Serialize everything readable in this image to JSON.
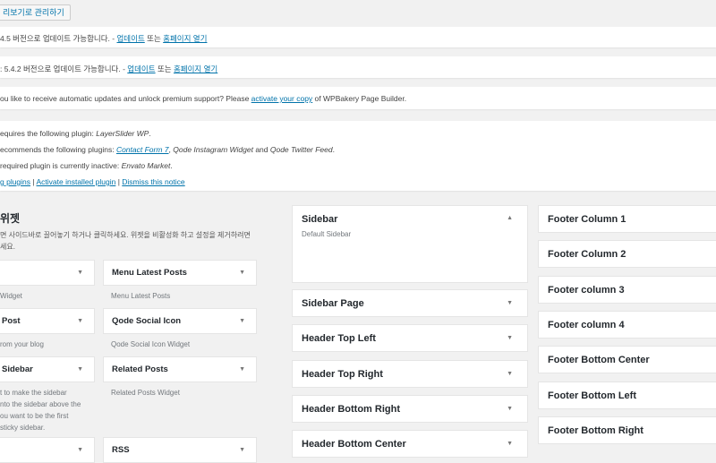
{
  "manage_button": "리보기로 관리하기",
  "notices": [
    {
      "text": "4.5 버전으로 업데이트 가능합니다. - ",
      "update": "업데이트",
      "or": " 또는 ",
      "homepage": "홈페이지 열기"
    },
    {
      "text": ": 5.4.2 버전으로 업데이트 가능합니다. - ",
      "update": "업데이트",
      "or": " 또는 ",
      "homepage": "홈페이지 열기"
    }
  ],
  "wpbakery": {
    "text": "ou like to receive automatic updates and unlock premium support? Please ",
    "link": "activate your copy",
    "suffix": " of WPBakery Page Builder."
  },
  "plugins": {
    "line1": "equires the following plugin: ",
    "line1_em": "LayerSlider WP",
    "line2": "ecommends the following plugins: ",
    "contact": "Contact Form 7",
    "qiw": "Qode Instagram Widget",
    "and": " and ",
    "qtf": "Qode Twitter Feed",
    "line3": " required plugin is currently inactive: ",
    "line3_em": "Envato Market",
    "link1": "g plugins",
    "link2": "Activate installed plugin",
    "link3": "Dismiss this notice",
    "sep": " | "
  },
  "widgets": {
    "title": "위젯",
    "desc1": "면 사이드바로 끌어놓기 하거나 클릭하세요. 위젯을 비활성화 하고 설정을 제거하려면",
    "desc2": "세요.",
    "items": [
      {
        "title": "",
        "desc": "Widget"
      },
      {
        "title": "Menu Latest Posts",
        "desc": "Menu Latest Posts"
      },
      {
        "title": "Post",
        "desc": "rom your blog"
      },
      {
        "title": "Qode Social Icon",
        "desc": "Qode Social Icon Widget"
      },
      {
        "title": "Sidebar",
        "desc": "t to make the sidebar\nnto the sidebar above the\nou want to be the first\nsticky sidebar."
      },
      {
        "title": "Related Posts",
        "desc": "Related Posts Widget"
      },
      {
        "title": "",
        "desc": ""
      },
      {
        "title": "RSS",
        "desc": ""
      }
    ]
  },
  "sidebars": {
    "main": {
      "title": "Sidebar",
      "desc": "Default Sidebar"
    },
    "items": [
      "Sidebar Page",
      "Header Top Left",
      "Header Top Right",
      "Header Bottom Right",
      "Header Bottom Center"
    ]
  },
  "footers": [
    "Footer Column 1",
    "Footer Column 2",
    "Footer column 3",
    "Footer column 4",
    "Footer Bottom Center",
    "Footer Bottom Left",
    "Footer Bottom Right"
  ]
}
